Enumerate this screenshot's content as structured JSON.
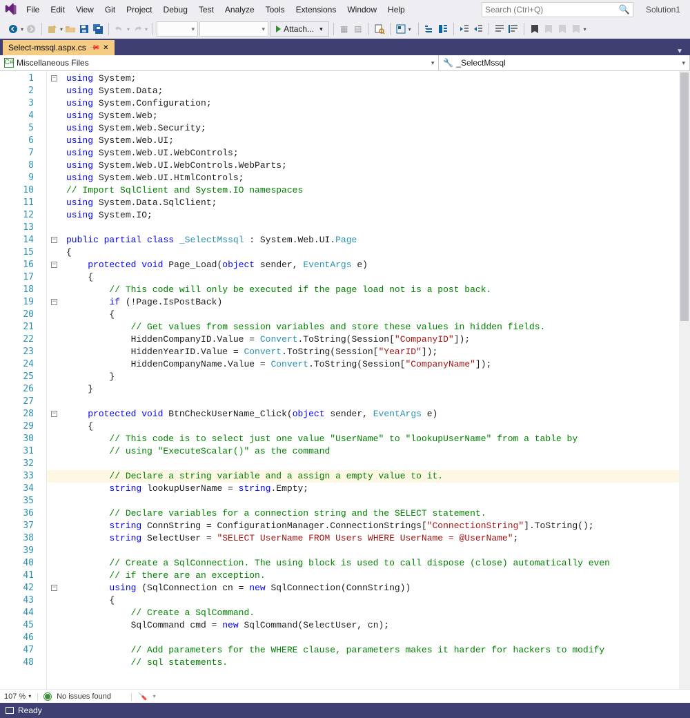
{
  "menu": [
    "File",
    "Edit",
    "View",
    "Git",
    "Project",
    "Debug",
    "Test",
    "Analyze",
    "Tools",
    "Extensions",
    "Window",
    "Help"
  ],
  "search_placeholder": "Search (Ctrl+Q)",
  "solution_name": "Solution1",
  "attach_label": "Attach...",
  "tab_name": "Select-mssql.aspx.cs",
  "nav_left": "Miscellaneous Files",
  "nav_right": "_SelectMssql",
  "zoom": "107 %",
  "issues": "No issues found",
  "status": "Ready",
  "code_lines": [
    {
      "n": 1,
      "fold": "-",
      "tokens": [
        {
          "t": "k",
          "v": "using"
        },
        {
          "v": " System;"
        }
      ]
    },
    {
      "n": 2,
      "tokens": [
        {
          "t": "k",
          "v": "using"
        },
        {
          "v": " System.Data;"
        }
      ]
    },
    {
      "n": 3,
      "tokens": [
        {
          "t": "k",
          "v": "using"
        },
        {
          "v": " System.Configuration;"
        }
      ]
    },
    {
      "n": 4,
      "tokens": [
        {
          "t": "k",
          "v": "using"
        },
        {
          "v": " System.Web;"
        }
      ]
    },
    {
      "n": 5,
      "tokens": [
        {
          "t": "k",
          "v": "using"
        },
        {
          "v": " System.Web.Security;"
        }
      ]
    },
    {
      "n": 6,
      "tokens": [
        {
          "t": "k",
          "v": "using"
        },
        {
          "v": " System.Web.UI;"
        }
      ]
    },
    {
      "n": 7,
      "tokens": [
        {
          "t": "k",
          "v": "using"
        },
        {
          "v": " System.Web.UI.WebControls;"
        }
      ]
    },
    {
      "n": 8,
      "tokens": [
        {
          "t": "k",
          "v": "using"
        },
        {
          "v": " System.Web.UI.WebControls.WebParts;"
        }
      ]
    },
    {
      "n": 9,
      "tokens": [
        {
          "t": "k",
          "v": "using"
        },
        {
          "v": " System.Web.UI.HtmlControls;"
        }
      ]
    },
    {
      "n": 10,
      "tokens": [
        {
          "t": "c",
          "v": "// Import SqlClient and System.IO namespaces"
        }
      ]
    },
    {
      "n": 11,
      "tokens": [
        {
          "t": "k",
          "v": "using"
        },
        {
          "v": " System.Data.SqlClient;"
        }
      ]
    },
    {
      "n": 12,
      "tokens": [
        {
          "t": "k",
          "v": "using"
        },
        {
          "v": " System.IO;"
        }
      ]
    },
    {
      "n": 13,
      "tokens": []
    },
    {
      "n": 14,
      "fold": "-",
      "tokens": [
        {
          "t": "k",
          "v": "public"
        },
        {
          "v": " "
        },
        {
          "t": "k",
          "v": "partial"
        },
        {
          "v": " "
        },
        {
          "t": "k",
          "v": "class"
        },
        {
          "v": " "
        },
        {
          "t": "t",
          "v": "_SelectMssql"
        },
        {
          "v": " : System.Web.UI."
        },
        {
          "t": "t",
          "v": "Page"
        }
      ]
    },
    {
      "n": 15,
      "tokens": [
        {
          "v": "{"
        }
      ]
    },
    {
      "n": 16,
      "fold": "-",
      "tokens": [
        {
          "v": "    "
        },
        {
          "t": "k",
          "v": "protected"
        },
        {
          "v": " "
        },
        {
          "t": "k",
          "v": "void"
        },
        {
          "v": " Page_Load("
        },
        {
          "t": "k",
          "v": "object"
        },
        {
          "v": " sender, "
        },
        {
          "t": "t",
          "v": "EventArgs"
        },
        {
          "v": " e)"
        }
      ]
    },
    {
      "n": 17,
      "tokens": [
        {
          "v": "    {"
        }
      ]
    },
    {
      "n": 18,
      "tokens": [
        {
          "v": "        "
        },
        {
          "t": "c",
          "v": "// This code will only be executed if the page load not is a post back."
        }
      ]
    },
    {
      "n": 19,
      "fold": "-",
      "tokens": [
        {
          "v": "        "
        },
        {
          "t": "k",
          "v": "if"
        },
        {
          "v": " (!Page.IsPostBack)"
        }
      ]
    },
    {
      "n": 20,
      "tokens": [
        {
          "v": "        {"
        }
      ]
    },
    {
      "n": 21,
      "tokens": [
        {
          "v": "            "
        },
        {
          "t": "c",
          "v": "// Get values from session variables and store these values in hidden fields."
        }
      ]
    },
    {
      "n": 22,
      "tokens": [
        {
          "v": "            HiddenCompanyID.Value = "
        },
        {
          "t": "t",
          "v": "Convert"
        },
        {
          "v": ".ToString(Session["
        },
        {
          "t": "s",
          "v": "\"CompanyID\""
        },
        {
          "v": "]);"
        }
      ]
    },
    {
      "n": 23,
      "tokens": [
        {
          "v": "            HiddenYearID.Value = "
        },
        {
          "t": "t",
          "v": "Convert"
        },
        {
          "v": ".ToString(Session["
        },
        {
          "t": "s",
          "v": "\"YearID\""
        },
        {
          "v": "]);"
        }
      ]
    },
    {
      "n": 24,
      "tokens": [
        {
          "v": "            HiddenCompanyName.Value = "
        },
        {
          "t": "t",
          "v": "Convert"
        },
        {
          "v": ".ToString(Session["
        },
        {
          "t": "s",
          "v": "\"CompanyName\""
        },
        {
          "v": "]);"
        }
      ]
    },
    {
      "n": 25,
      "tokens": [
        {
          "v": "        }"
        }
      ]
    },
    {
      "n": 26,
      "tokens": [
        {
          "v": "    }"
        }
      ]
    },
    {
      "n": 27,
      "tokens": []
    },
    {
      "n": 28,
      "fold": "-",
      "tokens": [
        {
          "v": "    "
        },
        {
          "t": "k",
          "v": "protected"
        },
        {
          "v": " "
        },
        {
          "t": "k",
          "v": "void"
        },
        {
          "v": " BtnCheckUserName_Click("
        },
        {
          "t": "k",
          "v": "object"
        },
        {
          "v": " sender, "
        },
        {
          "t": "t",
          "v": "EventArgs"
        },
        {
          "v": " e)"
        }
      ]
    },
    {
      "n": 29,
      "tokens": [
        {
          "v": "    {"
        }
      ]
    },
    {
      "n": 30,
      "tokens": [
        {
          "v": "        "
        },
        {
          "t": "c",
          "v": "// This code is to select just one value \"UserName\" to \"lookupUserName\" from a table by"
        }
      ]
    },
    {
      "n": 31,
      "tokens": [
        {
          "v": "        "
        },
        {
          "t": "c",
          "v": "// using \"ExecuteScalar()\" as the command"
        }
      ]
    },
    {
      "n": 32,
      "tokens": []
    },
    {
      "n": 33,
      "hl": true,
      "tokens": [
        {
          "v": "        "
        },
        {
          "t": "c",
          "v": "// Declare a string variable and a assign a empty value to it."
        }
      ]
    },
    {
      "n": 34,
      "tokens": [
        {
          "v": "        "
        },
        {
          "t": "k",
          "v": "string"
        },
        {
          "v": " lookupUserName = "
        },
        {
          "t": "k",
          "v": "string"
        },
        {
          "v": ".Empty;"
        }
      ]
    },
    {
      "n": 35,
      "tokens": []
    },
    {
      "n": 36,
      "tokens": [
        {
          "v": "        "
        },
        {
          "t": "c",
          "v": "// Declare variables for a connection string and the SELECT statement."
        }
      ]
    },
    {
      "n": 37,
      "tokens": [
        {
          "v": "        "
        },
        {
          "t": "k",
          "v": "string"
        },
        {
          "v": " ConnString = ConfigurationManager.ConnectionStrings["
        },
        {
          "t": "s",
          "v": "\"ConnectionString\""
        },
        {
          "v": "].ToString();"
        }
      ]
    },
    {
      "n": 38,
      "tokens": [
        {
          "v": "        "
        },
        {
          "t": "k",
          "v": "string"
        },
        {
          "v": " SelectUser = "
        },
        {
          "t": "s",
          "v": "\"SELECT UserName FROM Users WHERE UserName = @UserName\""
        },
        {
          "v": ";"
        }
      ]
    },
    {
      "n": 39,
      "tokens": []
    },
    {
      "n": 40,
      "tokens": [
        {
          "v": "        "
        },
        {
          "t": "c",
          "v": "// Create a SqlConnection. The using block is used to call dispose (close) automatically even"
        }
      ]
    },
    {
      "n": 41,
      "tokens": [
        {
          "v": "        "
        },
        {
          "t": "c",
          "v": "// if there are an exception."
        }
      ]
    },
    {
      "n": 42,
      "fold": "-",
      "tokens": [
        {
          "v": "        "
        },
        {
          "t": "k",
          "v": "using"
        },
        {
          "v": " (SqlConnection cn = "
        },
        {
          "t": "k",
          "v": "new"
        },
        {
          "v": " SqlConnection(ConnString))"
        }
      ]
    },
    {
      "n": 43,
      "tokens": [
        {
          "v": "        {"
        }
      ]
    },
    {
      "n": 44,
      "tokens": [
        {
          "v": "            "
        },
        {
          "t": "c",
          "v": "// Create a SqlCommand."
        }
      ]
    },
    {
      "n": 45,
      "tokens": [
        {
          "v": "            SqlCommand cmd = "
        },
        {
          "t": "k",
          "v": "new"
        },
        {
          "v": " SqlCommand(SelectUser, cn);"
        }
      ]
    },
    {
      "n": 46,
      "tokens": []
    },
    {
      "n": 47,
      "tokens": [
        {
          "v": "            "
        },
        {
          "t": "c",
          "v": "// Add parameters for the WHERE clause, parameters makes it harder for hackers to modify"
        }
      ]
    },
    {
      "n": 48,
      "tokens": [
        {
          "v": "            "
        },
        {
          "t": "c",
          "v": "// sql statements."
        }
      ]
    }
  ]
}
